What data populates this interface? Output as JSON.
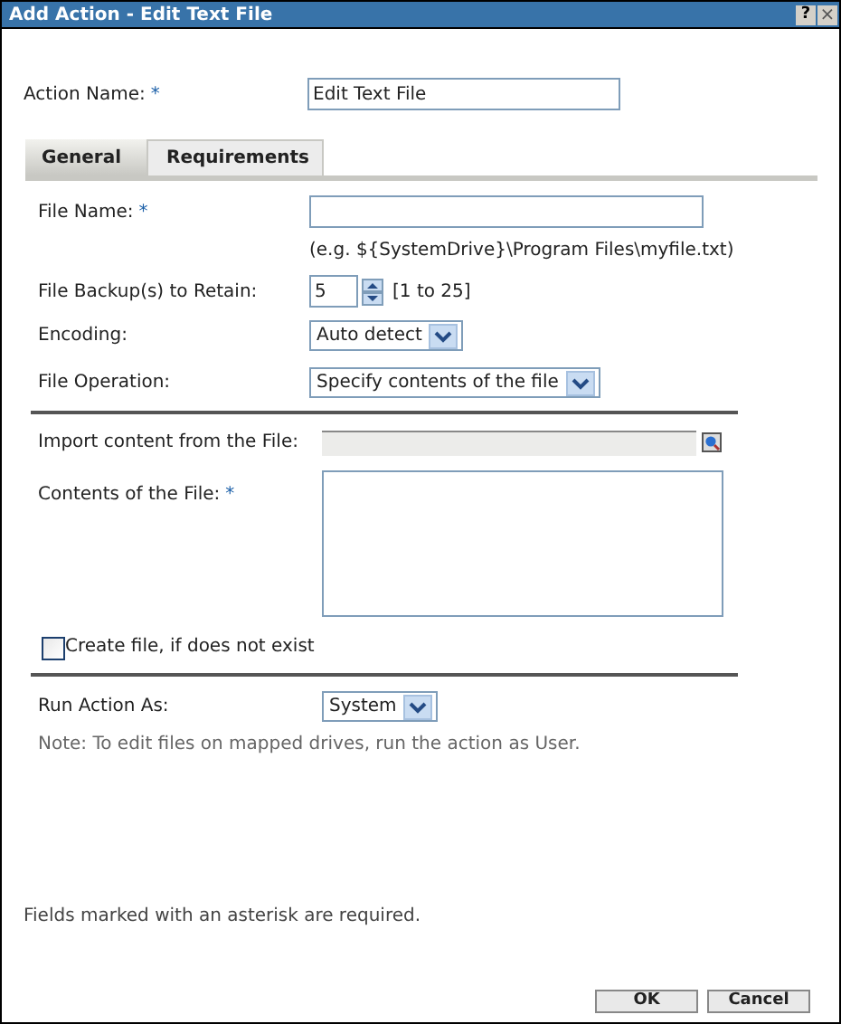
{
  "window": {
    "title": "Add Action - Edit Text File",
    "help_button": "?",
    "close_button": "×"
  },
  "action_name": {
    "label": "Action Name:",
    "asterisk": "*",
    "value": "Edit Text File"
  },
  "tabs": [
    {
      "label": "General",
      "selected": true
    },
    {
      "label": "Requirements",
      "selected": false
    }
  ],
  "general": {
    "file_name": {
      "label": "File Name:",
      "asterisk": "*",
      "value_hint": "(e.g. ${SystemDrive}\\Program Files\\myfile.txt)"
    },
    "backups": {
      "label": "File Backup(s) to Retain:",
      "value": "5",
      "range": "[1 to 25]"
    },
    "encoding": {
      "label": "Encoding:",
      "value": "Auto detect"
    },
    "file_operation": {
      "label": "File Operation:",
      "value": "Specify contents of the file"
    },
    "import": {
      "label": "Import content from the File:",
      "disabled": true
    },
    "contents": {
      "label": "Contents of the File:",
      "asterisk": "*"
    },
    "create_file": {
      "label": "Create file, if does not exist",
      "checked": false
    },
    "run_as": {
      "label": "Run Action As:",
      "value": "System"
    },
    "note": "Note: To edit files on mapped drives, run the action as User."
  },
  "footer_note": "Fields marked with an asterisk are required.",
  "buttons": [
    "OK",
    "Cancel"
  ]
}
